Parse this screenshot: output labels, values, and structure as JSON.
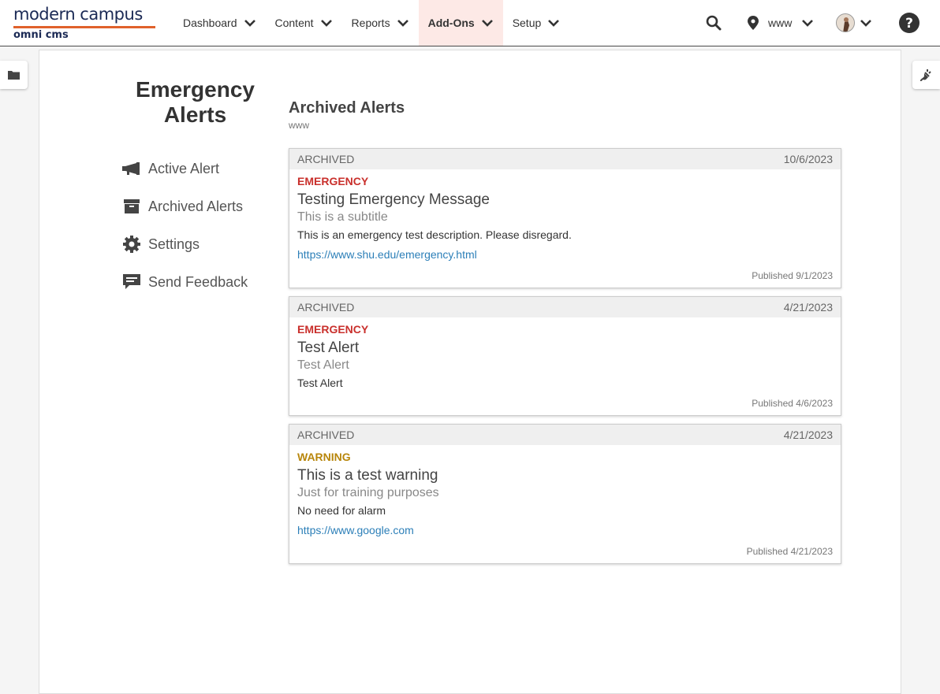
{
  "logo": {
    "top": "modern campus",
    "bottom": "omni cms"
  },
  "nav": [
    {
      "label": "Dashboard"
    },
    {
      "label": "Content"
    },
    {
      "label": "Reports"
    },
    {
      "label": "Add-Ons"
    },
    {
      "label": "Setup"
    }
  ],
  "site": {
    "name": "www"
  },
  "app": {
    "title_line1": "Emergency",
    "title_line2": "Alerts"
  },
  "sidenav": [
    {
      "label": "Active Alert",
      "icon": "megaphone-icon"
    },
    {
      "label": "Archived Alerts",
      "icon": "archive-box-icon"
    },
    {
      "label": "Settings",
      "icon": "gear-icon"
    },
    {
      "label": "Send Feedback",
      "icon": "comment-icon"
    }
  ],
  "main": {
    "title": "Archived Alerts",
    "subtitle": "www"
  },
  "alerts": [
    {
      "status": "ARCHIVED",
      "date": "10/6/2023",
      "level": "EMERGENCY",
      "title": "Testing Emergency Message",
      "subtitle": "This is a subtitle",
      "description": "This is an emergency test description. Please disregard.",
      "link": "https://www.shu.edu/emergency.html",
      "published": "Published 9/1/2023"
    },
    {
      "status": "ARCHIVED",
      "date": "4/21/2023",
      "level": "EMERGENCY",
      "title": "Test Alert",
      "subtitle": "Test Alert",
      "description": "Test Alert",
      "link": "",
      "published": "Published 4/6/2023"
    },
    {
      "status": "ARCHIVED",
      "date": "4/21/2023",
      "level": "WARNING",
      "title": "This is a test warning",
      "subtitle": "Just for training purposes",
      "description": "No need for alarm",
      "link": "https://www.google.com",
      "published": "Published 4/21/2023"
    }
  ],
  "colors": {
    "accent": "#e0612b",
    "brand": "#1b2a55",
    "emergency": "#c9302c",
    "warning": "#b8860b",
    "link": "#2c7fb8",
    "active_nav_bg": "#fde9e6"
  }
}
